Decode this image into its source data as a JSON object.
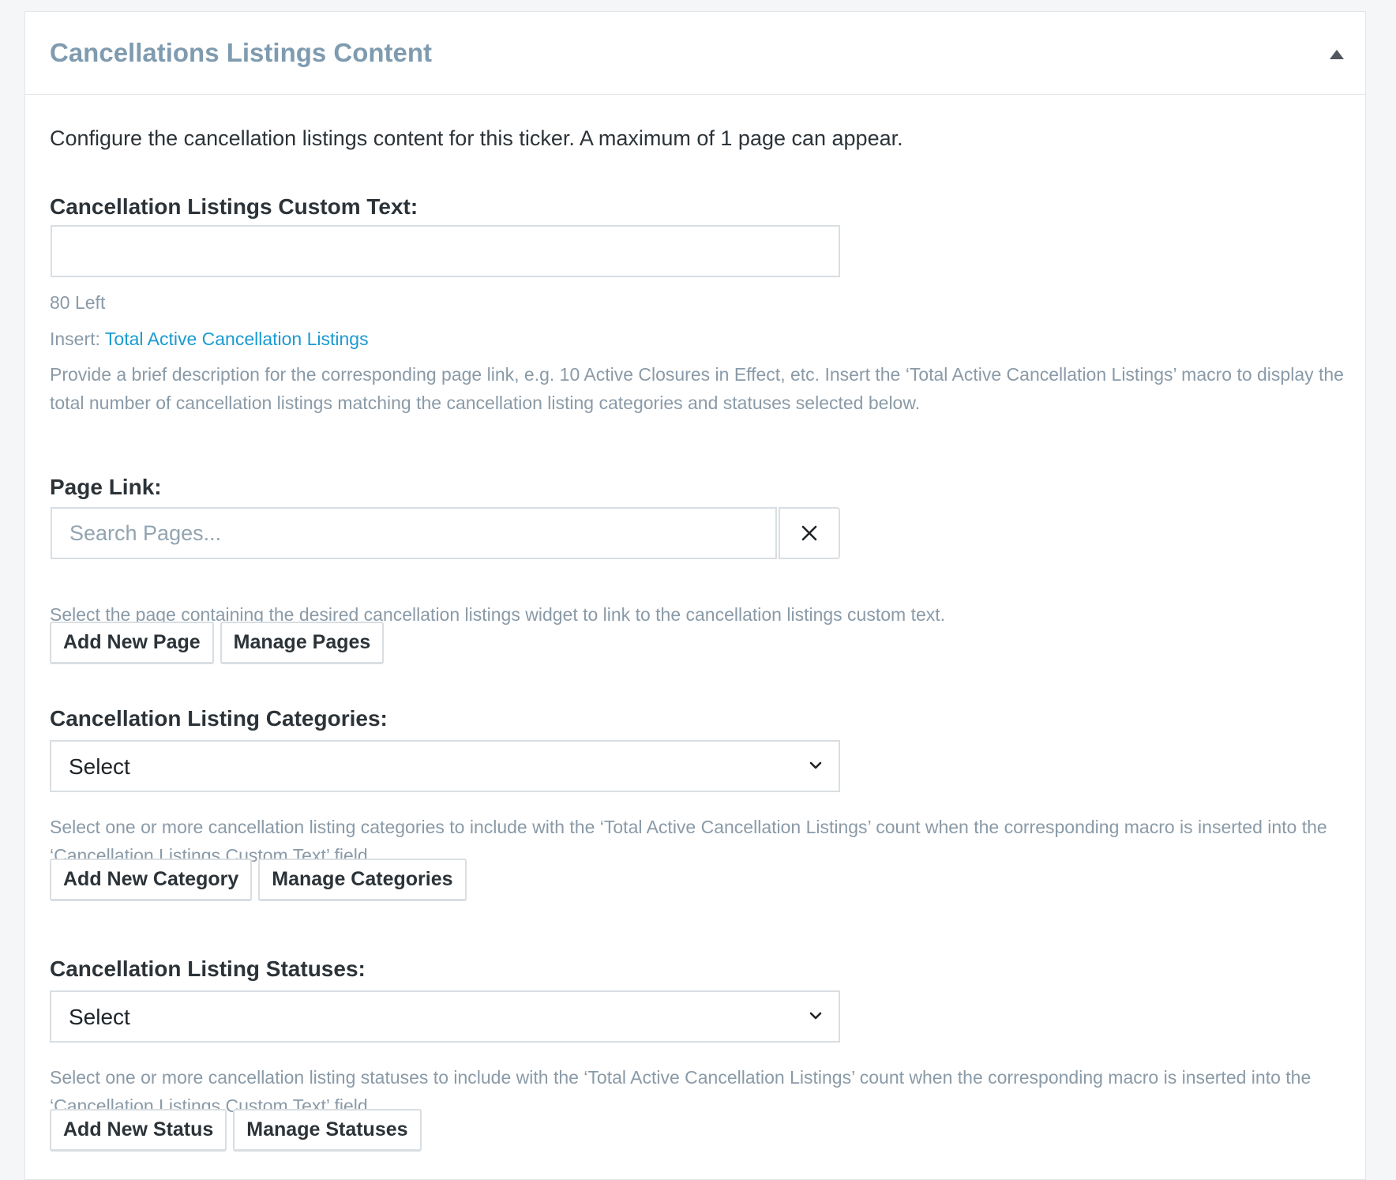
{
  "panel": {
    "title": "Cancellations Listings Content",
    "intro": "Configure the cancellation listings content for this ticker. A maximum of 1 page can appear."
  },
  "custom_text": {
    "label": "Cancellation Listings Custom Text:",
    "value": "",
    "counter": "80 Left",
    "insert_prefix": "Insert:",
    "insert_link": "Total Active Cancellation Listings",
    "help": "Provide a brief description for the corresponding page link, e.g. 10 Active Closures in Effect, etc. Insert the ‘Total Active Cancellation Listings’ macro to display the total number of cancellation listings matching the cancellation listing categories and statuses selected below."
  },
  "page_link": {
    "label": "Page Link:",
    "placeholder": "Search Pages...",
    "help": "Select the page containing the desired cancellation listings widget to link to the cancellation listings custom text.",
    "add_button": "Add New Page",
    "manage_button": "Manage Pages"
  },
  "categories": {
    "label": "Cancellation Listing Categories:",
    "selected": "Select",
    "help": "Select one or more cancellation listing categories to include with the ‘Total Active Cancellation Listings’ count when the corresponding macro is inserted into the ‘Cancellation Listings Custom Text’ field.",
    "add_button": "Add New Category",
    "manage_button": "Manage Categories"
  },
  "statuses": {
    "label": "Cancellation Listing Statuses:",
    "selected": "Select",
    "help": "Select one or more cancellation listing statuses to include with the ‘Total Active Cancellation Listings’ count when the corresponding macro is inserted into the ‘Cancellation Listings Custom Text’ field.",
    "add_button": "Add New Status",
    "manage_button": "Manage Statuses"
  },
  "icons": {
    "collapse": "caret-up-icon",
    "clear": "close-icon",
    "dropdown": "chevron-down-icon"
  },
  "colors": {
    "title": "#7f9bb0",
    "link": "#1b9ad1",
    "muted": "#8a9aa7",
    "text": "#2c3338",
    "border": "#d9dee2"
  }
}
